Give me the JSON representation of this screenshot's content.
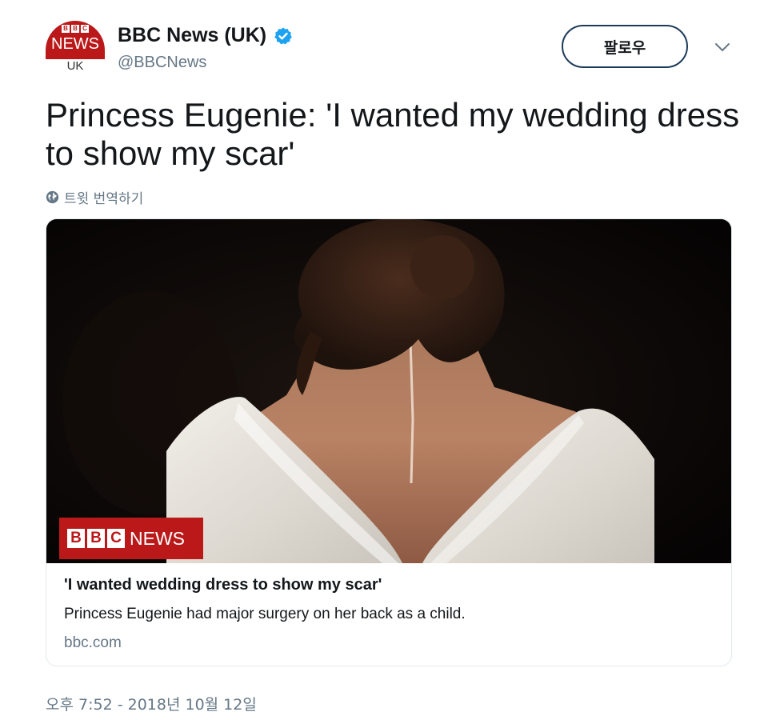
{
  "account": {
    "avatar_blocks": [
      "B",
      "B",
      "C"
    ],
    "avatar_news": "NEWS",
    "avatar_region": "UK",
    "display_name": "BBC News (UK)",
    "handle": "@BBCNews",
    "verified": true,
    "follow_label": "팔로우"
  },
  "tweet": {
    "text": "Princess Eugenie: 'I wanted my wedding dress to show my scar'",
    "translate_label": "트윗 번역하기",
    "timestamp": "오후 7:52 - 2018년 10월 12일"
  },
  "card": {
    "logo_blocks": [
      "B",
      "B",
      "C"
    ],
    "logo_news": "NEWS",
    "title": "'I wanted wedding dress to show my scar'",
    "description": "Princess Eugenie had major surgery on her back as a child.",
    "domain": "bbc.com"
  },
  "colors": {
    "bbc_red": "#bb1919",
    "verified_blue": "#1da1f2",
    "muted_text": "#657786"
  },
  "icons": {
    "verified": "verified-badge-icon",
    "more": "chevron-down-icon",
    "translate": "globe-icon"
  }
}
